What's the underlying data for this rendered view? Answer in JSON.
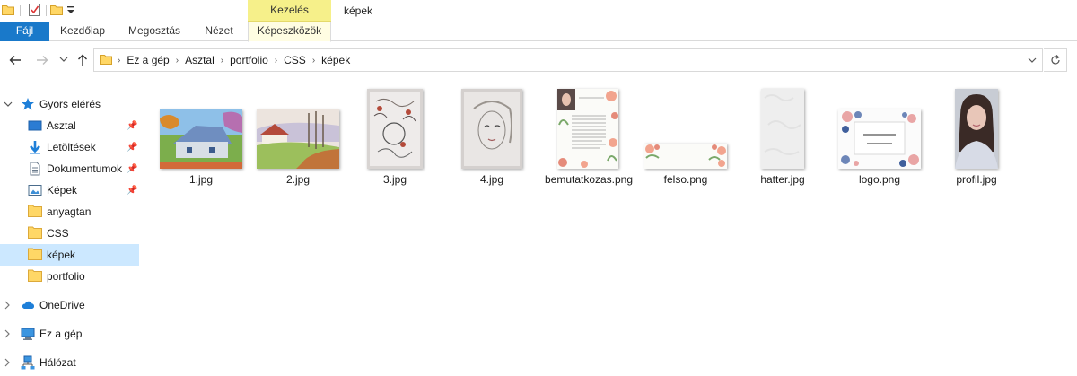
{
  "window_title": "képek",
  "ribbon": {
    "context_group": "Kezelés",
    "tabs": [
      "Fájl",
      "Kezdőlap",
      "Megosztás",
      "Nézet",
      "Képeszközök"
    ]
  },
  "breadcrumb": [
    "Ez a gép",
    "Asztal",
    "portfolio",
    "CSS",
    "képek"
  ],
  "sidebar": {
    "items": [
      {
        "label": "Gyors elérés",
        "icon": "star-icon"
      },
      {
        "label": "Asztal",
        "icon": "desktop-icon",
        "pinned": true
      },
      {
        "label": "Letöltések",
        "icon": "download-icon",
        "pinned": true
      },
      {
        "label": "Dokumentumok",
        "icon": "documents-icon",
        "pinned": true
      },
      {
        "label": "Képek",
        "icon": "pictures-icon",
        "pinned": true
      },
      {
        "label": "anyagtan",
        "icon": "folder-icon"
      },
      {
        "label": "CSS",
        "icon": "folder-icon"
      },
      {
        "label": "képek",
        "icon": "folder-icon",
        "selected": true
      },
      {
        "label": "portfolio",
        "icon": "folder-icon"
      },
      {
        "label": "OneDrive",
        "icon": "cloud-icon"
      },
      {
        "label": "Ez a gép",
        "icon": "computer-icon"
      },
      {
        "label": "Hálózat",
        "icon": "network-icon"
      }
    ]
  },
  "files": [
    {
      "name": "1.jpg"
    },
    {
      "name": "2.jpg"
    },
    {
      "name": "3.jpg"
    },
    {
      "name": "4.jpg"
    },
    {
      "name": "bemutatkozas.png"
    },
    {
      "name": "felso.png"
    },
    {
      "name": "hatter.jpg"
    },
    {
      "name": "logo.png"
    },
    {
      "name": "profil.jpg"
    }
  ],
  "colors": {
    "file_tab": "#1979ca",
    "context_tab": "#f6f08a",
    "selection": "#cce8ff"
  }
}
